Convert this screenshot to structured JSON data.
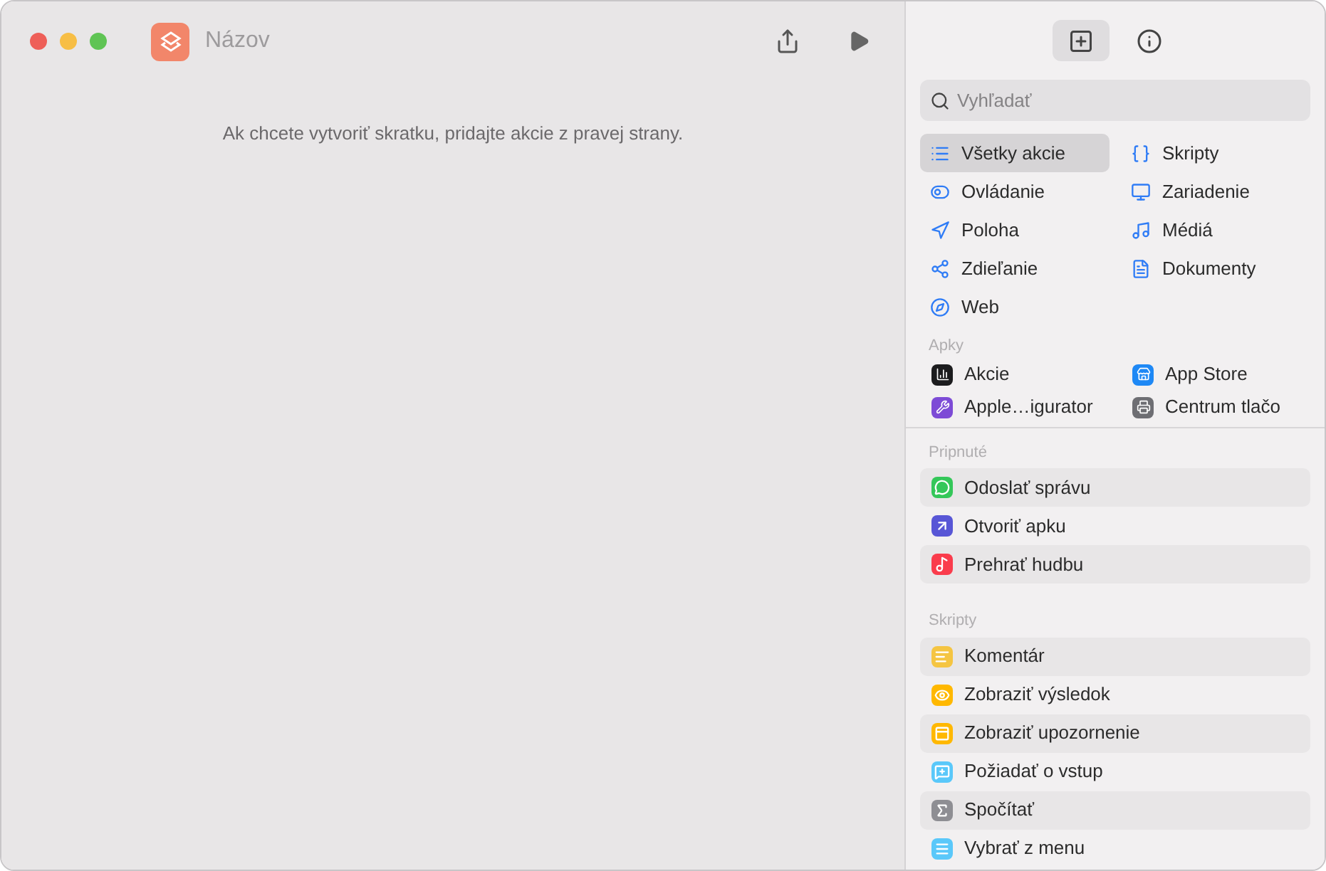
{
  "window": {
    "title": "Názov"
  },
  "editor": {
    "hint": "Ak chcete vytvoriť skratku, pridajte akcie z pravej strany."
  },
  "panel_tabs": [
    {
      "kind": "library",
      "selected": true
    },
    {
      "kind": "info",
      "selected": false
    }
  ],
  "search": {
    "placeholder": "Vyhľadať"
  },
  "categories": [
    {
      "label": "Všetky akcie",
      "selected": true
    },
    {
      "label": "Skripty",
      "selected": false
    },
    {
      "label": "Ovládanie",
      "selected": false
    },
    {
      "label": "Zariadenie",
      "selected": false
    },
    {
      "label": "Poloha",
      "selected": false
    },
    {
      "label": "Médiá",
      "selected": false
    },
    {
      "label": "Zdieľanie",
      "selected": false
    },
    {
      "label": "Dokumenty",
      "selected": false
    },
    {
      "label": "Web",
      "selected": false
    }
  ],
  "apps": {
    "title": "Apky",
    "items": [
      {
        "label": "Akcie",
        "color": "#1c1c1e"
      },
      {
        "label": "App Store",
        "color": "#1e88f5"
      },
      {
        "label": "Apple…igurator",
        "color": "#7d4bd6"
      },
      {
        "label": "Centrum tlačo",
        "color": "#6e6e73"
      }
    ]
  },
  "pinned": {
    "title": "Pripnuté",
    "items": [
      {
        "label": "Odoslať správu",
        "color": "#34c759"
      },
      {
        "label": "Otvoriť apku",
        "color": "#5856d6"
      },
      {
        "label": "Prehrať hudbu",
        "color": "#fa3c4c"
      }
    ]
  },
  "scripts": {
    "title": "Skripty",
    "items": [
      {
        "label": "Komentár",
        "color": "#f5c542"
      },
      {
        "label": "Zobraziť výsledok",
        "color": "#ffb800"
      },
      {
        "label": "Zobraziť upozornenie",
        "color": "#ffb800"
      },
      {
        "label": "Požiadať o vstup",
        "color": "#5ac8fa"
      },
      {
        "label": "Spočítať",
        "color": "#8e8e93"
      },
      {
        "label": "Vybrať z menu",
        "color": "#5ac8fa"
      }
    ]
  }
}
